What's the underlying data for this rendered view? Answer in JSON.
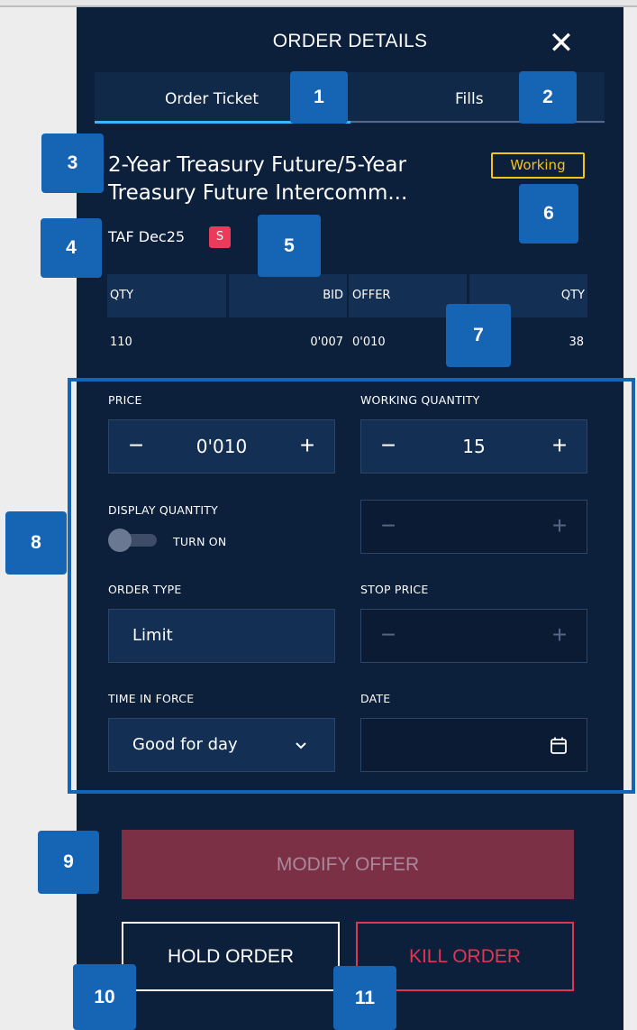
{
  "header": {
    "title": "ORDER DETAILS",
    "close_glyph": "✕",
    "close_icon": "close-icon"
  },
  "tabs": {
    "ticket": "Order Ticket",
    "fills": "Fills",
    "active": "Order Ticket"
  },
  "instrument": {
    "name_line1": "2-Year Treasury Future/5-Year",
    "name_line2": "Treasury Future Intercomm...",
    "status": "Working",
    "symbol": "TAF Dec25",
    "side_badge": "S"
  },
  "quote": {
    "headers": [
      "QTY",
      "BID",
      "OFFER",
      "QTY"
    ],
    "values": [
      "110",
      "0'007",
      "0'010",
      "38"
    ]
  },
  "form": {
    "price_label": "PRICE",
    "price_value": "0'010",
    "working_qty_label": "WORKING QUANTITY",
    "working_qty_value": "15",
    "display_qty_label": "DISPLAY QUANTITY",
    "toggle_label": "TURN ON",
    "toggle_on": false,
    "order_type_label": "ORDER TYPE",
    "order_type_value": "Limit",
    "stop_price_label": "STOP PRICE",
    "tif_label": "TIME IN FORCE",
    "tif_value": "Good for day",
    "date_label": "DATE",
    "minus_glyph": "−",
    "plus_glyph": "+",
    "chevron_icon": "chevron-down-icon",
    "calendar_icon": "calendar-icon"
  },
  "actions": {
    "modify": "MODIFY OFFER",
    "hold": "HOLD ORDER",
    "kill": "KILL ORDER"
  },
  "callouts": [
    "1",
    "2",
    "3",
    "4",
    "5",
    "6",
    "7",
    "8",
    "9",
    "10",
    "11"
  ],
  "colors": {
    "panel_bg": "#0c1f3b",
    "accent_blue": "#3cb6ff",
    "callout_blue": "#1565b4",
    "working_yellow": "#f5c31a",
    "sell_red": "#ec3b5a",
    "kill_red": "#e23552",
    "modify_bg": "#7b3046"
  }
}
